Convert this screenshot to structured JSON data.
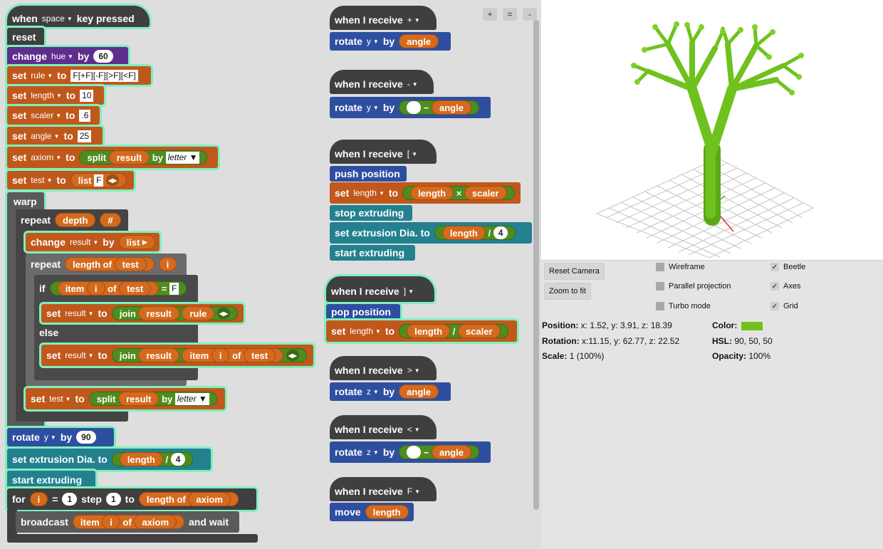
{
  "colors": {
    "tree_green": "#6fc21e",
    "tree_dark": "#4d8d13",
    "swatch": "#6fc21e"
  },
  "zoom": {
    "plus": "+",
    "equal": "=",
    "minus": "-"
  },
  "main": {
    "hat": {
      "when": "when",
      "key": "space",
      "pressed": "key pressed"
    },
    "reset": "reset",
    "change_hue": {
      "change": "change",
      "var": "hue",
      "by": "by",
      "val": "60"
    },
    "set_rule": {
      "set": "set",
      "var": "rule",
      "to": "to",
      "val": "F[+F][-F][>F][<F]"
    },
    "set_length": {
      "set": "set",
      "var": "length",
      "to": "to",
      "val": "10"
    },
    "set_scaler": {
      "set": "set",
      "var": "scaler",
      "to": "to",
      "val": ".6"
    },
    "set_angle": {
      "set": "set",
      "var": "angle",
      "to": "to",
      "val": "25"
    },
    "set_axiom": {
      "set": "set",
      "var": "axiom",
      "to": "to",
      "split": "split",
      "result": "result",
      "by": "by",
      "mode": "letter"
    },
    "set_test": {
      "set": "set",
      "var": "test",
      "to": "to",
      "list": "list",
      "item": "F"
    },
    "warp": "warp",
    "repeat_depth": {
      "repeat": "repeat",
      "depth": "depth",
      "hash": "#"
    },
    "change_result": {
      "change": "change",
      "var": "result",
      "by": "by",
      "list": "list"
    },
    "repeat_len": {
      "repeat": "repeat",
      "length_of": "length of",
      "test": "test",
      "i": "i"
    },
    "if_block": {
      "if": "if",
      "item": "item",
      "i": "i",
      "of": "of",
      "test": "test",
      "eq": "=",
      "val": "F"
    },
    "set_join1": {
      "set": "set",
      "var": "result",
      "to": "to",
      "join": "join",
      "result": "result",
      "rule": "rule"
    },
    "else": "else",
    "set_join2": {
      "set": "set",
      "var": "result",
      "to": "to",
      "join": "join",
      "result": "result",
      "item": "item",
      "i": "i",
      "of": "of",
      "test": "test"
    },
    "set_test2": {
      "set": "set",
      "var": "test",
      "to": "to",
      "split": "split",
      "result": "result",
      "by": "by",
      "mode": "letter"
    },
    "rotate_y": {
      "rotate": "rotate",
      "axis": "y",
      "by": "by",
      "val": "90"
    },
    "set_extrusion": {
      "label": "set extrusion Dia. to",
      "length": "length",
      "div": "/",
      "val": "4"
    },
    "start_extruding": "start extruding",
    "for_loop": {
      "for": "for",
      "i": "i",
      "eq": "=",
      "start": "1",
      "step": "step",
      "stepv": "1",
      "to": "to",
      "length_of": "length of",
      "axiom": "axiom"
    },
    "broadcast": {
      "broadcast": "broadcast",
      "item": "item",
      "i": "i",
      "of": "of",
      "axiom": "axiom",
      "wait": "and wait"
    }
  },
  "events": {
    "plus": {
      "when": "when I receive",
      "msg": "+",
      "rotate": "rotate",
      "axis": "y",
      "by": "by",
      "angle": "angle"
    },
    "minus": {
      "when": "when I receive",
      "msg": "-",
      "rotate": "rotate",
      "axis": "y",
      "by": "by",
      "op": "−",
      "angle": "angle"
    },
    "bracket_open": {
      "when": "when I receive",
      "msg": "[",
      "push": "push position",
      "set": "set",
      "var": "length",
      "to": "to",
      "length": "length",
      "times": "×",
      "scaler": "scaler",
      "stop": "stop extruding",
      "extr": "set extrusion Dia. to",
      "div": "/",
      "val": "4",
      "start": "start extruding"
    },
    "bracket_close": {
      "when": "when I receive",
      "msg": "]",
      "pop": "pop position",
      "set": "set",
      "var": "length",
      "to": "to",
      "length": "length",
      "div": "/",
      "scaler": "scaler"
    },
    "gt": {
      "when": "when I receive",
      "msg": ">",
      "rotate": "rotate",
      "axis": "z",
      "by": "by",
      "angle": "angle"
    },
    "lt": {
      "when": "when I receive",
      "msg": "<",
      "rotate": "rotate",
      "axis": "z",
      "by": "by",
      "op": "−",
      "angle": "angle"
    },
    "f": {
      "when": "when I receive",
      "msg": "F",
      "move": "move",
      "length": "length"
    }
  },
  "panel": {
    "reset_camera": "Reset Camera",
    "zoom_fit": "Zoom to fit",
    "wireframe": "Wireframe",
    "parallel": "Parallel projection",
    "turbo": "Turbo mode",
    "beetle": "Beetle",
    "axes": "Axes",
    "grid": "Grid",
    "check": "✓",
    "position_label": "Position:",
    "position_value": "x: 1.52, y: 3.91, z: 18.39",
    "rotation_label": "Rotation:",
    "rotation_value": "x:11.15, y: 62.77, z: 22.52",
    "scale_label": "Scale:",
    "scale_value": "1 (100%)",
    "color_label": "Color:",
    "hsl_label": "HSL:",
    "hsl_value": "90, 50, 50",
    "opacity_label": "Opacity:",
    "opacity_value": "100%"
  }
}
